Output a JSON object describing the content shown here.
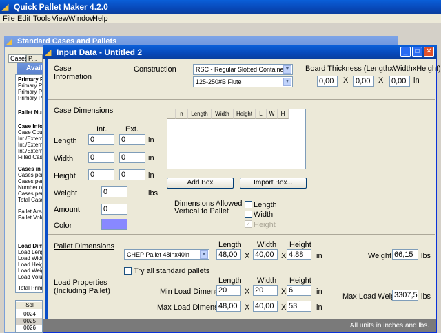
{
  "app": {
    "title": "Quick Pallet Maker 4.2.0"
  },
  "menu": [
    "File",
    "Edit",
    "Tools",
    "View",
    "Window",
    "Help"
  ],
  "bg_window": {
    "title": "Standard Cases and Pallets",
    "tabs": [
      "Cases",
      "P..."
    ],
    "available_label": "Avail",
    "left_lines": [
      "Primary P",
      "Primary Pa",
      "Primary Pa",
      "Primary Pa",
      "Pallet Num",
      "Case Info",
      "Case Coun",
      "Int./Extern",
      "Int./Extern",
      "Int./Extern",
      "Filled Case",
      "Cases in P",
      "Cases per",
      "Cases per",
      "Number of",
      "Cases per",
      "Total Cases",
      "Pallet Area",
      "Pallet Volu",
      "Load Dim",
      "Load Leng",
      "Load Widt",
      "Load Heigh",
      "Load Weig",
      "Load Volu",
      "Total Prima"
    ],
    "grid_header": "Sol",
    "grid_rows": [
      "0024",
      "0025",
      "0026"
    ]
  },
  "input_window": {
    "title": "Input Data - Untitled 2",
    "case_info_label_1": "Case",
    "case_info_label_2": "Information",
    "construction_label": "Construction",
    "construction_value": "RSC - Regular Slotted Container",
    "flute_value": "125-250#B Flute",
    "board_thickness_label": "Board Thickness (LengthxWidthxHeight)",
    "board_thickness": [
      "0,00",
      "0,00",
      "0,00"
    ],
    "x_sep": "X",
    "in_unit": "in",
    "case_dimensions_label": "Case Dimensions",
    "int_label": "Int.",
    "ext_label": "Ext.",
    "length_label": "Length",
    "width_label": "Width",
    "height_label": "Height",
    "weight_label": "Weight",
    "amount_label": "Amount",
    "color_label": "Color",
    "length_int": "0",
    "length_ext": "0",
    "width_int": "0",
    "width_ext": "0",
    "height_int": "0",
    "height_ext": "0",
    "weight": "0",
    "weight_unit": "lbs",
    "amount": "0",
    "color_swatch": "#8888ff",
    "table_headers": [
      "n",
      "Length",
      "Width",
      "Height",
      "L",
      "W",
      "H"
    ],
    "add_box": "Add Box",
    "import_box": "Import Box...",
    "dims_allowed_1": "Dimensions Allowed",
    "dims_allowed_2": "Vertical to Pallet",
    "chk_length": "Length",
    "chk_width": "Width",
    "chk_height": "Height",
    "pallet_dimensions_label": "Pallet Dimensions",
    "pallet_value": "CHEP Pallet 48inx40in",
    "col_length": "Length",
    "col_width": "Width",
    "col_height": "Height",
    "pallet_length": "48,00",
    "pallet_width": "40,00",
    "pallet_height": "4,88",
    "pallet_weight_label": "Weight",
    "pallet_weight": "66,15",
    "lbs": "lbs",
    "try_all_label": "Try all standard pallets",
    "load_props_1": "Load Properties",
    "load_props_2": "(Including Pallet)",
    "min_load_label": "Min Load Dimensions",
    "max_load_label": "Max Load Dimensions",
    "min_length": "20",
    "min_width": "20",
    "min_height": "6",
    "max_length": "48,00",
    "max_width": "40,00",
    "max_height": "53",
    "max_load_weight_label": "Max Load Weight",
    "max_load_weight": "3307,5",
    "status": "All units in inches and lbs."
  }
}
